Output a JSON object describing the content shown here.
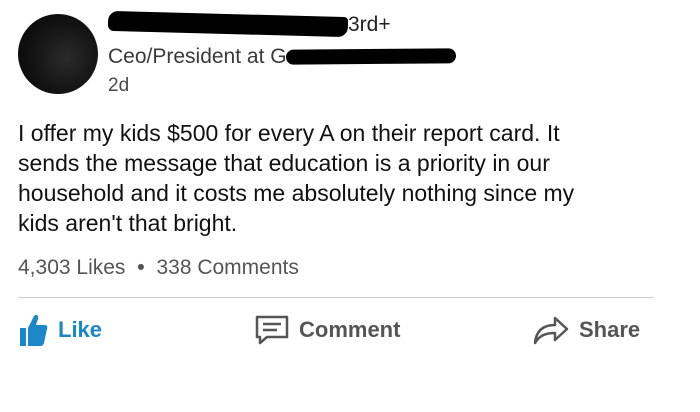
{
  "post": {
    "author": {
      "connection_degree": "3rd+",
      "headline": "Ceo/President at G",
      "time_ago": "2d"
    },
    "text_lines": [
      "I offer my kids $500 for every A on their report card. It",
      "sends the message that education is a priority in our",
      "household and it costs me absolutely nothing since my",
      "kids aren't that bright."
    ],
    "stats": {
      "likes": "4,303 Likes",
      "separator": "•",
      "comments": "338 Comments"
    },
    "actions": {
      "like_label": "Like",
      "comment_label": "Comment",
      "share_label": "Share"
    },
    "colors": {
      "like_accent": "#1b86c8",
      "muted_text": "#555555"
    }
  }
}
